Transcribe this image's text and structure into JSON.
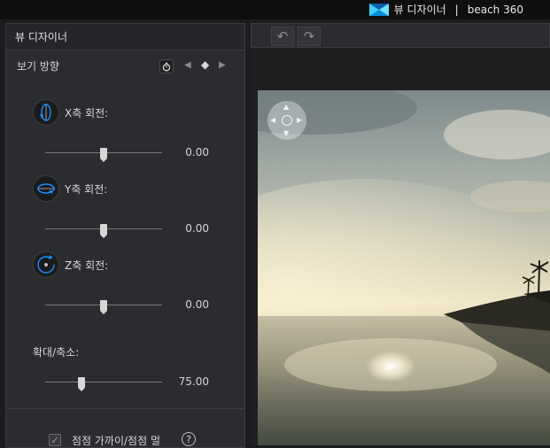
{
  "window": {
    "app_name": "뷰 디자이너",
    "separator": "|",
    "project_name": "beach 360"
  },
  "panel": {
    "title": "뷰 디자이너",
    "section_title": "보기 방향",
    "controls": [
      {
        "label": "X축 회전:",
        "value": "0.00",
        "position": 0.5
      },
      {
        "label": "Y축 회전:",
        "value": "0.00",
        "position": 0.5
      },
      {
        "label": "Z축 회전:",
        "value": "0.00",
        "position": 0.5
      }
    ],
    "zoom": {
      "label": "확대/축소:",
      "value": "75.00",
      "position": 0.3
    },
    "fade": {
      "label": "점점 가까이/점점 멀",
      "checked": true
    },
    "help_symbol": "?"
  },
  "toolbar": {
    "undo_symbol": "↶",
    "redo_symbol": "↷"
  },
  "icons": {
    "keyframe_prev": "◀",
    "keyframe_diamond": "◆",
    "keyframe_next": "▶",
    "accent": "#1e90ff"
  }
}
